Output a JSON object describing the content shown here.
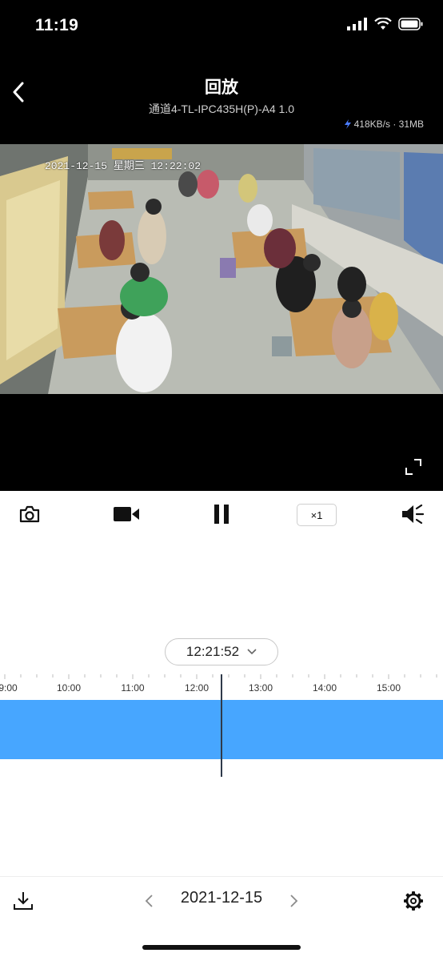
{
  "status_bar": {
    "time": "11:19"
  },
  "header": {
    "title": "回放",
    "subtitle": "通道4-TL-IPC435H(P)-A4 1.0",
    "speed_info": "418KB/s · 31MB"
  },
  "video": {
    "osd_timestamp": "2021-12-15 星期三 12:22:02"
  },
  "controls": {
    "playback_speed": "×1"
  },
  "timeline": {
    "current_time": "12:21:52",
    "hours": [
      "9:00",
      "10:00",
      "11:00",
      "12:00",
      "13:00",
      "14:00",
      "15:00"
    ]
  },
  "bottom_bar": {
    "date": "2021-12-15"
  },
  "colors": {
    "accent": "#47a6ff",
    "background_top": "#000000"
  }
}
